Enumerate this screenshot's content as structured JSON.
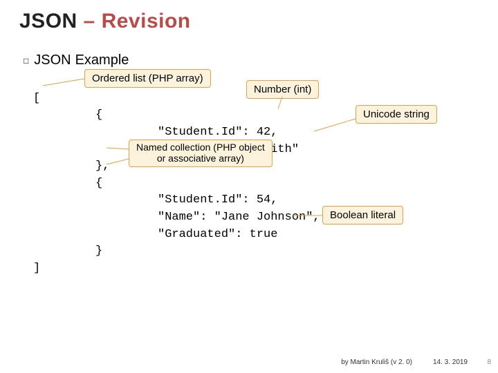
{
  "title": {
    "a": "JSON",
    "dash": "–",
    "b": "Revision"
  },
  "heading": {
    "bullet": "□",
    "pre": "JSON",
    "post": "Example"
  },
  "code": {
    "l1": "[",
    "l2": "{",
    "l3": "\"Student.Id\": 42,",
    "l4": "\"Name\": \"John Smith\"",
    "l5": "},",
    "l6": "{",
    "l7": "\"Student.Id\": 54,",
    "l8": "\"Name\": \"Jane Johnson\",",
    "l9": "\"Graduated\": true",
    "l10": "}",
    "l11": "]"
  },
  "callouts": {
    "orderedList": "Ordered list (PHP array)",
    "numberInt": "Number (int)",
    "unicode": "Unicode string",
    "namedColl1": "Named collection (PHP object",
    "namedColl2": "or associative array)",
    "boolLit": "Boolean literal"
  },
  "footer": {
    "author": "by Martin Kruliš (v 2. 0)",
    "date": "14. 3. 2019",
    "page": "8"
  }
}
